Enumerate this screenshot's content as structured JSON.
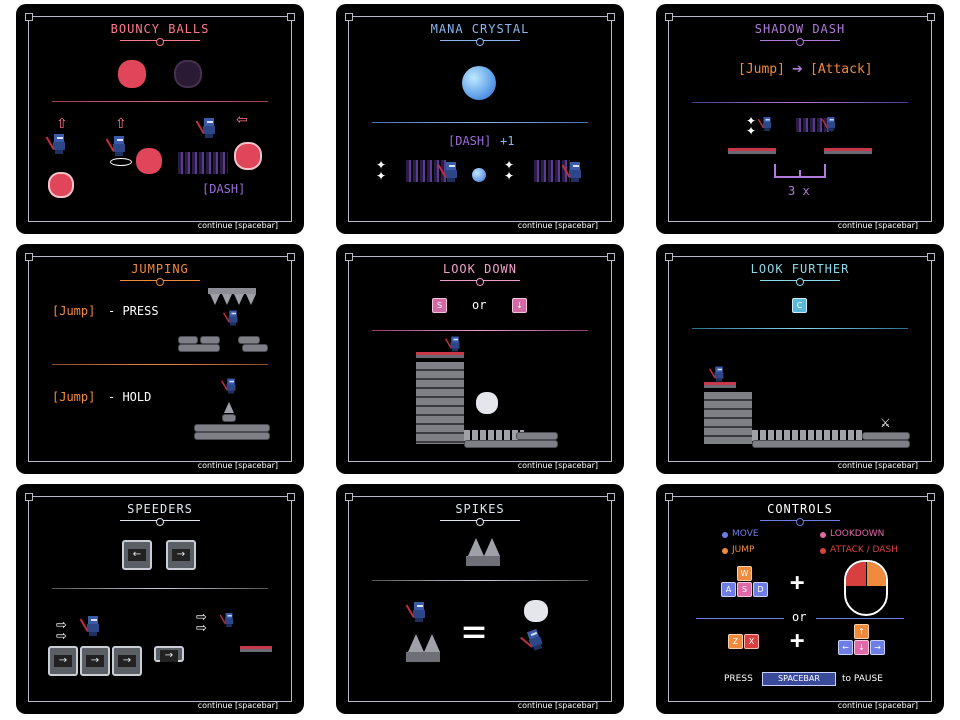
{
  "continue_label": "continue [spacebar]",
  "colors": {
    "ball_red": "#e0455a",
    "ball_dark": "#2a1a33",
    "accent_orange": "#f08a3c",
    "accent_purple": "#9a6bd9",
    "accent_blue": "#6cc8f0"
  },
  "cards": {
    "bouncy_balls": {
      "title": "BOUNCY BALLS",
      "dash_label": "[DASH]"
    },
    "mana_crystal": {
      "title": "MANA CRYSTAL",
      "dash_label": "[DASH]",
      "plus_label": "+1"
    },
    "shadow_dash": {
      "title": "SHADOW DASH",
      "jump_label": "[Jump]",
      "attack_label": "[Attack]",
      "times_label": "3 x"
    },
    "jumping": {
      "title": "JUMPING",
      "press_key": "[Jump]",
      "press_text": "- PRESS",
      "hold_key": "[Jump]",
      "hold_text": "- HOLD"
    },
    "look_down": {
      "title": "LOOK DOWN",
      "key_a": "S",
      "or_label": "or",
      "key_b": "↓"
    },
    "look_further": {
      "title": "LOOK FURTHER",
      "key": "C"
    },
    "speeders": {
      "title": "SPEEDERS"
    },
    "spikes": {
      "title": "SPIKES",
      "equals": "="
    },
    "controls": {
      "title": "CONTROLS",
      "legend": [
        {
          "label": "MOVE",
          "color": "#6f7ee6"
        },
        {
          "label": "LOOKDOWN",
          "color": "#e06aa8"
        },
        {
          "label": "JUMP",
          "color": "#f08a3c"
        },
        {
          "label": "ATTACK / DASH",
          "color": "#d84040"
        }
      ],
      "keys_wasd": [
        "W",
        "A",
        "S",
        "D"
      ],
      "keys_zx": [
        "Z",
        "X"
      ],
      "keys_arrows": [
        "↑",
        "←",
        "↓",
        "→"
      ],
      "plus": "+",
      "or_label": "or",
      "press_label": "PRESS",
      "spacebar_label": "SPACEBAR",
      "pause_label": "to PAUSE"
    }
  }
}
